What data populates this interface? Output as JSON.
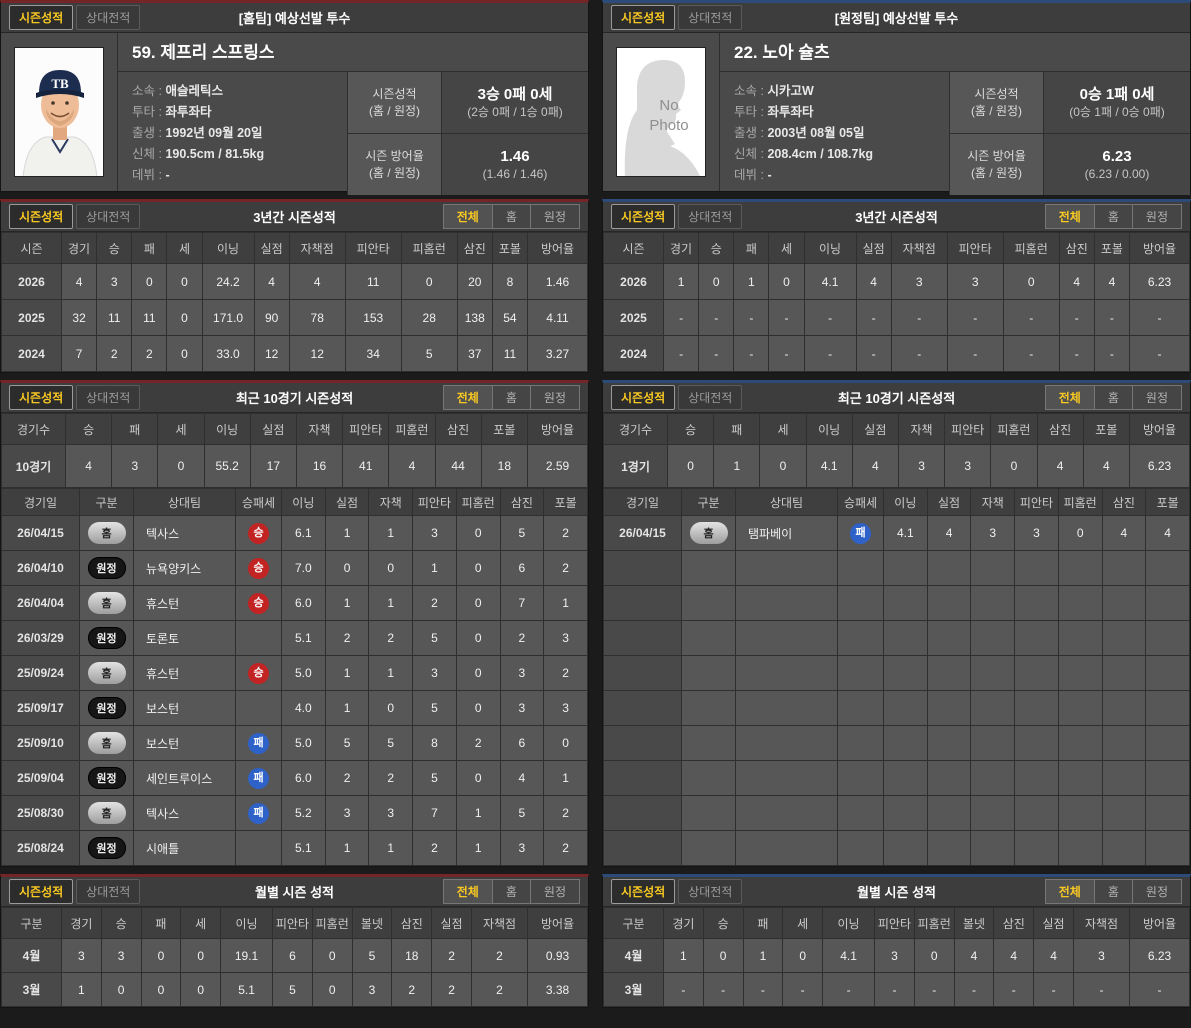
{
  "colors": {
    "home_accent": "#742528",
    "away_accent": "#2d4b78",
    "active_text": "#f8c822",
    "win_badge": "#c22323",
    "loss_badge": "#2f62c8"
  },
  "common": {
    "tabs": [
      "시즌성적",
      "상대전적"
    ],
    "filters": [
      "전체",
      "홈",
      "원정"
    ],
    "record_label": "시즌성적",
    "era_label": "시즌 방어율",
    "home_away_label": "(홈 / 원정)",
    "no_photo_line1": "No",
    "no_photo_line2": "Photo"
  },
  "panels": {
    "home": {
      "info_header": {
        "title": "[홈팀] 예상선발 투수",
        "filters": false
      },
      "player_name": "59. 제프리 스프링스",
      "details": [
        {
          "label": "소속",
          "value": "애슬레틱스"
        },
        {
          "label": "투타",
          "value": "좌투좌타"
        },
        {
          "label": "출생",
          "value": "1992년 09월 20일"
        },
        {
          "label": "신체",
          "value": "190.5cm / 81.5kg"
        },
        {
          "label": "데뷔",
          "value": "-"
        }
      ],
      "record": {
        "value": "3승 0패 0세",
        "sub": "(2승 0패 / 1승 0패)"
      },
      "era": {
        "value": "1.46",
        "sub": "(1.46 / 1.46)"
      },
      "three_year": {
        "title": "3년간 시즌성적",
        "filters": true,
        "columns": [
          "시즌",
          "경기",
          "승",
          "패",
          "세",
          "이닝",
          "실점",
          "자책점",
          "피안타",
          "피홈런",
          "삼진",
          "포볼",
          "방어율"
        ],
        "rows": [
          [
            "2026",
            "4",
            "3",
            "0",
            "0",
            "24.2",
            "4",
            "4",
            "11",
            "0",
            "20",
            "8",
            "1.46"
          ],
          [
            "2025",
            "32",
            "11",
            "11",
            "0",
            "171.0",
            "90",
            "78",
            "153",
            "28",
            "138",
            "54",
            "4.11"
          ],
          [
            "2024",
            "7",
            "2",
            "2",
            "0",
            "33.0",
            "12",
            "12",
            "34",
            "5",
            "37",
            "11",
            "3.27"
          ]
        ]
      },
      "recent": {
        "title": "최근 10경기 시즌성적",
        "filters": true
      },
      "recent_summary": {
        "columns": [
          "경기수",
          "승",
          "패",
          "세",
          "이닝",
          "실점",
          "자책",
          "피안타",
          "피홈런",
          "삼진",
          "포볼",
          "방어율"
        ],
        "rows": [
          [
            "10경기",
            "4",
            "3",
            "0",
            "55.2",
            "17",
            "16",
            "41",
            "4",
            "44",
            "18",
            "2.59"
          ]
        ]
      },
      "recent_log": {
        "columns": [
          "경기일",
          "구분",
          "상대팀",
          "승패세",
          "이닝",
          "실점",
          "자책",
          "피안타",
          "피홈런",
          "삼진",
          "포볼"
        ],
        "rows": [
          {
            "date": "26/04/15",
            "where": "홈",
            "opponent": "텍사스",
            "result": "승",
            "stats": [
              "6.1",
              "1",
              "1",
              "3",
              "0",
              "5",
              "2"
            ]
          },
          {
            "date": "26/04/10",
            "where": "원정",
            "opponent": "뉴욕양키스",
            "result": "승",
            "stats": [
              "7.0",
              "0",
              "0",
              "1",
              "0",
              "6",
              "2"
            ]
          },
          {
            "date": "26/04/04",
            "where": "홈",
            "opponent": "휴스턴",
            "result": "승",
            "stats": [
              "6.0",
              "1",
              "1",
              "2",
              "0",
              "7",
              "1"
            ]
          },
          {
            "date": "26/03/29",
            "where": "원정",
            "opponent": "토론토",
            "result": "",
            "stats": [
              "5.1",
              "2",
              "2",
              "5",
              "0",
              "2",
              "3"
            ]
          },
          {
            "date": "25/09/24",
            "where": "홈",
            "opponent": "휴스턴",
            "result": "승",
            "stats": [
              "5.0",
              "1",
              "1",
              "3",
              "0",
              "3",
              "2"
            ]
          },
          {
            "date": "25/09/17",
            "where": "원정",
            "opponent": "보스턴",
            "result": "",
            "stats": [
              "4.0",
              "1",
              "0",
              "5",
              "0",
              "3",
              "3"
            ]
          },
          {
            "date": "25/09/10",
            "where": "홈",
            "opponent": "보스턴",
            "result": "패",
            "stats": [
              "5.0",
              "5",
              "5",
              "8",
              "2",
              "6",
              "0"
            ]
          },
          {
            "date": "25/09/04",
            "where": "원정",
            "opponent": "세인트루이스",
            "result": "패",
            "stats": [
              "6.0",
              "2",
              "2",
              "5",
              "0",
              "4",
              "1"
            ]
          },
          {
            "date": "25/08/30",
            "where": "홈",
            "opponent": "텍사스",
            "result": "패",
            "stats": [
              "5.2",
              "3",
              "3",
              "7",
              "1",
              "5",
              "2"
            ]
          },
          {
            "date": "25/08/24",
            "where": "원정",
            "opponent": "시애틀",
            "result": "",
            "stats": [
              "5.1",
              "1",
              "1",
              "2",
              "1",
              "3",
              "2"
            ]
          }
        ]
      },
      "monthly": {
        "title": "월별 시즌 성적",
        "filters": true,
        "columns": [
          "구분",
          "경기",
          "승",
          "패",
          "세",
          "이닝",
          "피안타",
          "피홈런",
          "볼넷",
          "삼진",
          "실점",
          "자책점",
          "방어율"
        ],
        "rows": [
          [
            "4월",
            "3",
            "3",
            "0",
            "0",
            "19.1",
            "6",
            "0",
            "5",
            "18",
            "2",
            "2",
            "0.93"
          ],
          [
            "3월",
            "1",
            "0",
            "0",
            "0",
            "5.1",
            "5",
            "0",
            "3",
            "2",
            "2",
            "2",
            "3.38"
          ]
        ]
      }
    },
    "away": {
      "info_header": {
        "title": "[원정팀] 예상선발 투수",
        "filters": false
      },
      "player_name": "22. 노아 슐츠",
      "details": [
        {
          "label": "소속",
          "value": "시카고W"
        },
        {
          "label": "투타",
          "value": "좌투좌타"
        },
        {
          "label": "출생",
          "value": "2003년 08월 05일"
        },
        {
          "label": "신체",
          "value": "208.4cm / 108.7kg"
        },
        {
          "label": "데뷔",
          "value": "-"
        }
      ],
      "record": {
        "value": "0승 1패 0세",
        "sub": "(0승 1패 / 0승 0패)"
      },
      "era": {
        "value": "6.23",
        "sub": "(6.23 / 0.00)"
      },
      "three_year": {
        "title": "3년간 시즌성적",
        "filters": true,
        "columns": [
          "시즌",
          "경기",
          "승",
          "패",
          "세",
          "이닝",
          "실점",
          "자책점",
          "피안타",
          "피홈런",
          "삼진",
          "포볼",
          "방어율"
        ],
        "rows": [
          [
            "2026",
            "1",
            "0",
            "1",
            "0",
            "4.1",
            "4",
            "3",
            "3",
            "0",
            "4",
            "4",
            "6.23"
          ],
          [
            "2025",
            "-",
            "-",
            "-",
            "-",
            "-",
            "-",
            "-",
            "-",
            "-",
            "-",
            "-",
            "-"
          ],
          [
            "2024",
            "-",
            "-",
            "-",
            "-",
            "-",
            "-",
            "-",
            "-",
            "-",
            "-",
            "-",
            "-"
          ]
        ]
      },
      "recent": {
        "title": "최근 10경기 시즌성적",
        "filters": true
      },
      "recent_summary": {
        "columns": [
          "경기수",
          "승",
          "패",
          "세",
          "이닝",
          "실점",
          "자책",
          "피안타",
          "피홈런",
          "삼진",
          "포볼",
          "방어율"
        ],
        "rows": [
          [
            "1경기",
            "0",
            "1",
            "0",
            "4.1",
            "4",
            "3",
            "3",
            "0",
            "4",
            "4",
            "6.23"
          ]
        ]
      },
      "recent_log": {
        "columns": [
          "경기일",
          "구분",
          "상대팀",
          "승패세",
          "이닝",
          "실점",
          "자책",
          "피안타",
          "피홈런",
          "삼진",
          "포볼"
        ],
        "rows": [
          {
            "date": "26/04/15",
            "where": "홈",
            "opponent": "탬파베이",
            "result": "패",
            "stats": [
              "4.1",
              "4",
              "3",
              "3",
              "0",
              "4",
              "4"
            ]
          },
          null,
          null,
          null,
          null,
          null,
          null,
          null,
          null,
          null
        ]
      },
      "monthly": {
        "title": "월별 시즌 성적",
        "filters": true,
        "columns": [
          "구분",
          "경기",
          "승",
          "패",
          "세",
          "이닝",
          "피안타",
          "피홈런",
          "볼넷",
          "삼진",
          "실점",
          "자책점",
          "방어율"
        ],
        "rows": [
          [
            "4월",
            "1",
            "0",
            "1",
            "0",
            "4.1",
            "3",
            "0",
            "4",
            "4",
            "4",
            "3",
            "6.23"
          ],
          [
            "3월",
            "-",
            "-",
            "-",
            "-",
            "-",
            "-",
            "-",
            "-",
            "-",
            "-",
            "-",
            "-"
          ]
        ]
      }
    }
  }
}
